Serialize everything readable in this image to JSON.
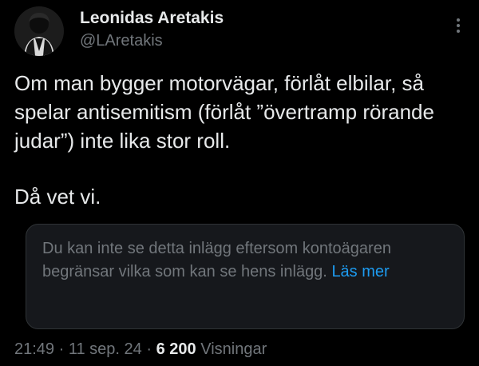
{
  "author": {
    "display_name": "Leonidas Aretakis",
    "handle": "@LAretakis"
  },
  "tweet": {
    "paragraph_1": "Om man bygger motorvägar, förlåt elbilar, så spelar antisemitism (förlåt ”övertramp rörande judar”) inte lika stor roll.",
    "paragraph_2": "Då vet vi."
  },
  "notice": {
    "text": "Du kan inte se detta inlägg eftersom kontoägaren begränsar vilka som kan se hens inlägg.",
    "link_label": "Läs mer"
  },
  "meta": {
    "time": "21:49",
    "separator": "·",
    "date": "11 sep. 24",
    "views_count": "6 200",
    "views_label": "Visningar"
  },
  "icons": {
    "more": "more-vertical-icon"
  },
  "colors": {
    "background": "#000000",
    "text_primary": "#e7e9ea",
    "text_secondary": "#71767b",
    "link": "#1d9bf0",
    "notice_background": "#16181c",
    "notice_border": "#2f3336"
  }
}
